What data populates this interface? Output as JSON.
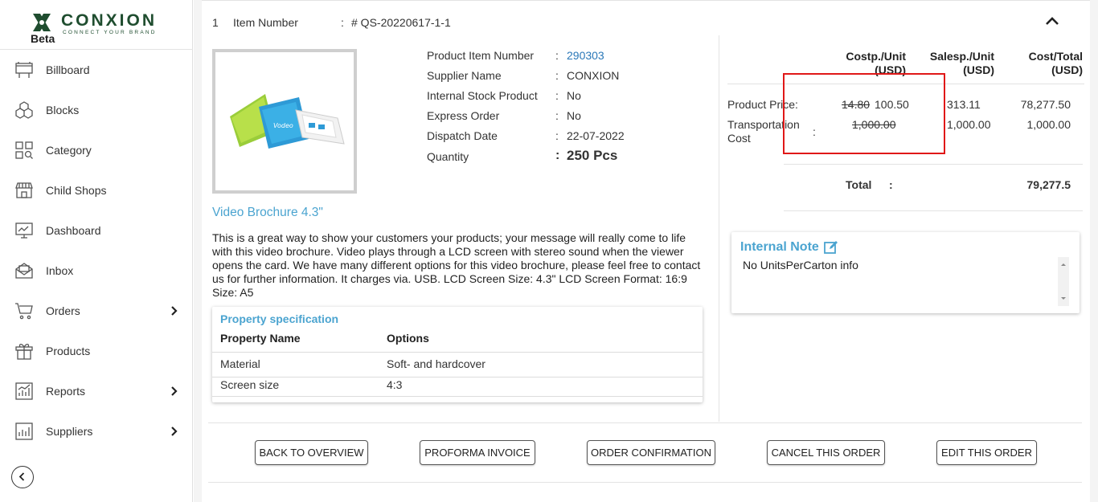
{
  "brand": {
    "name": "CONXION",
    "tagline": "CONNECT YOUR BRAND",
    "badge": "Beta"
  },
  "sidebar": {
    "items": [
      {
        "label": "Billboard",
        "icon": "billboard-icon"
      },
      {
        "label": "Blocks",
        "icon": "blocks-icon"
      },
      {
        "label": "Category",
        "icon": "category-icon"
      },
      {
        "label": "Child Shops",
        "icon": "shop-icon"
      },
      {
        "label": "Dashboard",
        "icon": "dashboard-icon"
      },
      {
        "label": "Inbox",
        "icon": "inbox-icon"
      },
      {
        "label": "Orders",
        "icon": "cart-icon",
        "has_submenu": true
      },
      {
        "label": "Products",
        "icon": "box-icon"
      },
      {
        "label": "Reports",
        "icon": "reports-icon",
        "has_submenu": true
      },
      {
        "label": "Suppliers",
        "icon": "suppliers-icon",
        "has_submenu": true
      }
    ]
  },
  "item": {
    "index": "1",
    "label": "Item Number",
    "colon": ":",
    "number": "# QS-20220617-1-1"
  },
  "details": {
    "rows": [
      {
        "label": "Product Item Number",
        "value": "290303"
      },
      {
        "label": "Supplier Name",
        "value": "CONXION"
      },
      {
        "label": "Internal Stock Product",
        "value": "No"
      },
      {
        "label": "Express Order",
        "value": "No"
      },
      {
        "label": "Dispatch Date",
        "value": "22-07-2022"
      },
      {
        "label": "Quantity",
        "value": "250 Pcs"
      }
    ],
    "colon": ":"
  },
  "product": {
    "title": "Video Brochure 4.3\"",
    "description": "This is a great way to show your customers your products; your message will really come to life with this video brochure. Video plays through a LCD screen with stereo sound when the viewer opens the card. We have many different options for this video brochure, please feel free to contact us for further information. It charges via. USB. LCD Screen Size: 4.3\" LCD Screen Format: 16:9 Size: A5"
  },
  "properties": {
    "title": "Property specification",
    "headers": [
      "Property Name",
      "Options"
    ],
    "rows": [
      [
        "Material",
        "Soft- and hardcover"
      ],
      [
        "Screen size",
        "4:3"
      ]
    ]
  },
  "pricing": {
    "headers": {
      "cost_unit": [
        "Costp./Unit",
        "(USD)"
      ],
      "sales_unit": [
        "Salesp./Unit",
        "(USD)"
      ],
      "cost_total": [
        "Cost/Total",
        "(USD)"
      ]
    },
    "product_price": {
      "label": "Product Price:",
      "old_cost": "14.80",
      "cost": "100.50",
      "sales": "313.11",
      "total": "78,277.50"
    },
    "transport": {
      "label1": "Transportation",
      "label2": "Cost",
      "colon": ":",
      "old_cost": "1,000.00",
      "sales": "1,000.00",
      "total": "1,000.00"
    },
    "total": {
      "label": "Total",
      "colon": ":",
      "value": "79,277.5"
    },
    "highlight_color": "#e01818"
  },
  "note": {
    "title": "Internal Note",
    "value": "No UnitsPerCarton info"
  },
  "buttons": {
    "back": "BACK TO OVERVIEW",
    "proforma": "PROFORMA INVOICE",
    "confirmation": "ORDER CONFIRMATION",
    "cancel": "CANCEL THIS ORDER",
    "edit": "EDIT THIS ORDER"
  },
  "colors": {
    "accent": "#4ba4d0",
    "link": "#2a78b8",
    "brand_green": "#1f4d2f"
  }
}
